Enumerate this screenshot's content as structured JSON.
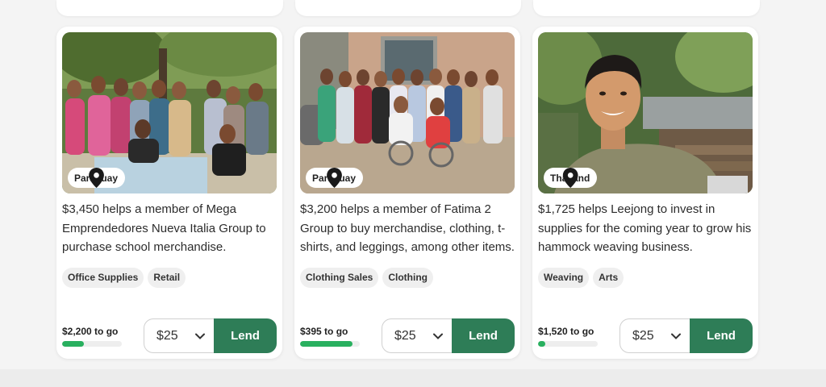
{
  "cards": [
    {
      "location": "Paraguay",
      "description": "$3,450 helps a member of Mega Emprendedores Nueva Italia Group to purchase school merchandise.",
      "tags": [
        "Office Supplies",
        "Retail"
      ],
      "to_go": "$2,200 to go",
      "progress": 0.36,
      "amount": "$25",
      "lend_label": "Lend",
      "photo_icon": "group-photo"
    },
    {
      "location": "Paraguay",
      "description": "$3,200 helps a member of Fatima 2 Group to buy merchandise, clothing, t-shirts, and leggings, among other items.",
      "tags": [
        "Clothing Sales",
        "Clothing"
      ],
      "to_go": "$395 to go",
      "progress": 0.88,
      "amount": "$25",
      "lend_label": "Lend",
      "photo_icon": "group-photo"
    },
    {
      "location": "Thailand",
      "description": "$1,725 helps Leejong to invest in supplies for the coming year to grow his hammock weaving business.",
      "tags": [
        "Weaving",
        "Arts"
      ],
      "to_go": "$1,520 to go",
      "progress": 0.12,
      "amount": "$25",
      "lend_label": "Lend",
      "photo_icon": "portrait-photo"
    }
  ],
  "colors": {
    "lend_button": "#2e7d57",
    "progress": "#29b05f",
    "tag_bg": "#efefef"
  }
}
